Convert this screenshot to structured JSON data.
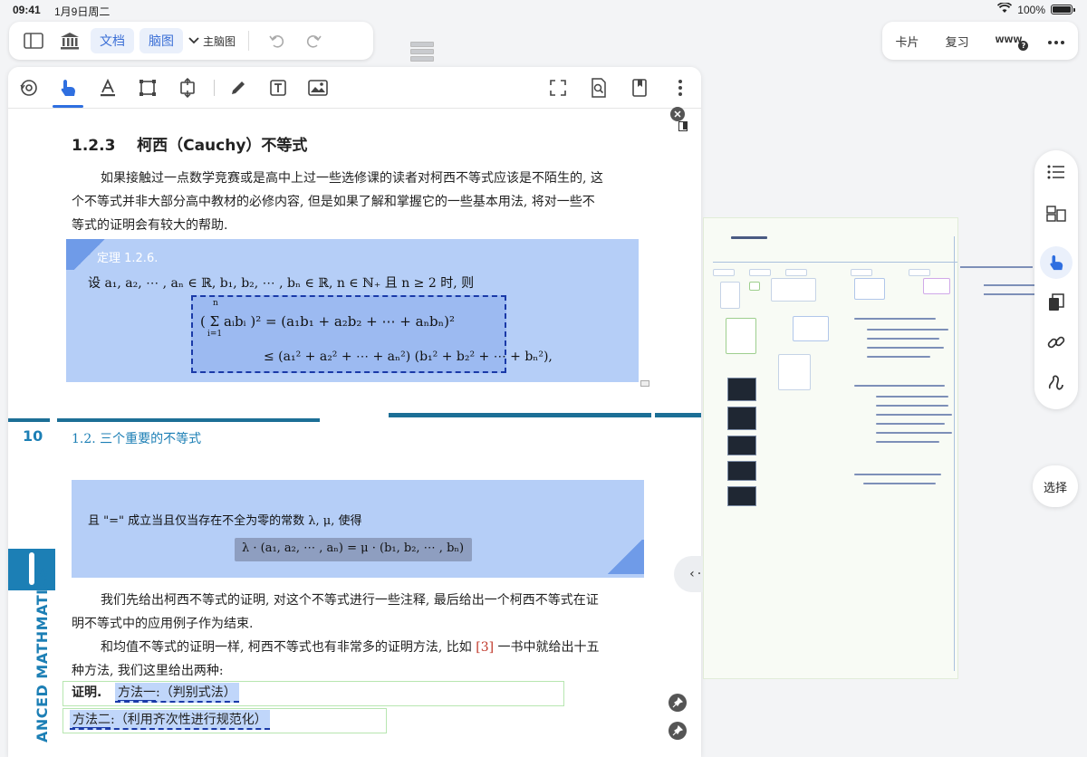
{
  "status_bar": {
    "time": "09:41",
    "date": "1月9日周二",
    "battery": "100%"
  },
  "toolbar_left": {
    "doc_tab": "文档",
    "mindmap_tab": "脑图",
    "mindmap_select": "主脑图"
  },
  "toolbar_right": {
    "cards": "卡片",
    "review": "复习",
    "www": "WWW"
  },
  "document": {
    "section_number": "1.2.3",
    "section_title": "柯西（Cauchy）不等式",
    "intro_lines": [
      "如果接触过一点数学竞赛或是高中上过一些选修课的读者对柯西不等式应该是不陌生的, 这",
      "个不等式并非大部分高中教材的必修内容, 但是如果了解和掌握它的一些基本用法, 将对一些不",
      "等式的证明会有较大的帮助."
    ],
    "theorem_label": "定理 1.2.6.",
    "theorem_condition": "设 a₁, a₂, ⋯ , aₙ ∈ ℝ, b₁, b₂, ⋯ , bₙ ∈ ℝ, n ∈ ℕ₊ 且 n ≥ 2 时, 则",
    "formula_line1": "( Σ aᵢbᵢ )² = (a₁b₁ + a₂b₂ + ⋯ + aₙbₙ)²",
    "formula_sum_top": "n",
    "formula_sum_bottom": "i=1",
    "formula_line2": "≤ (a₁² + a₂² + ⋯ + aₙ²) (b₁² + b₂² + ⋯ + bₙ²),",
    "page_number": "10",
    "running_head": "1.2.  三个重要的不等式",
    "side_text": "ANCED MATHMATICS",
    "equality_condition": "且 \"=\" 成立当且仅当存在不全为零的常数 λ, μ, 使得",
    "equality_formula": "λ · (a₁, a₂, ⋯ , aₙ) = μ · (b₁, b₂, ⋯ , bₙ)",
    "body_lines": [
      "我们先给出柯西不等式的证明, 对这个不等式进行一些注释, 最后给出一个柯西不等式在证",
      "明不等式中的应用例子作为结束."
    ],
    "methods_line1_before": "和均值不等式的证明一样, 柯西不等式也有非常多的证明方法, 比如 ",
    "methods_ref": "[3]",
    "methods_line1_after": " 一书中就给出十五",
    "methods_line2": "种方法, 我们这里给出两种:",
    "proof_label": "证明.",
    "method1_name": "方法一",
    "method1_desc": ":（判别式法）",
    "method2_name": "方法二",
    "method2_desc": ":（利用齐次性进行规范化）"
  },
  "right_panel": {
    "select_label": "选择"
  },
  "colors": {
    "accent": "#2f6fe0",
    "highlight": "#78a5f0",
    "teal": "#1c7fb5"
  }
}
